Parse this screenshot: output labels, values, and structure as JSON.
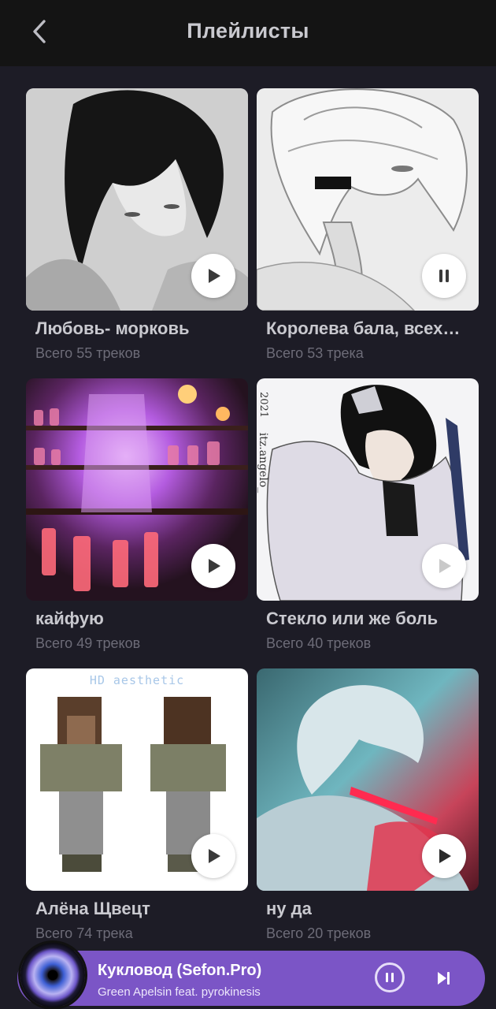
{
  "header": {
    "title": "Плейлисты",
    "back_icon": "chevron-left-icon"
  },
  "playlists": [
    {
      "name": "Любовь- морковь",
      "count": "Всего 55 треков",
      "state": "play"
    },
    {
      "name": "Королева бала, всех…",
      "count": "Всего 53 трека",
      "state": "pause"
    },
    {
      "name": "кайфую",
      "count": "Всего 49 треков",
      "state": "play"
    },
    {
      "name": "Стекло или же боль",
      "count": "Всего 40 треков",
      "state": "play"
    },
    {
      "name": "Алёна Щвецт",
      "count": "Всего 74 трека",
      "state": "play"
    },
    {
      "name": "ну да",
      "count": "Всего 20 треков",
      "state": "play"
    }
  ],
  "cover_texts": {
    "fourth_watermark_1": "2021",
    "fourth_watermark_2": "itz.angelo_",
    "fifth_watermark": "HD aesthetic"
  },
  "player": {
    "title": "Кукловод (Sefon.Pro)",
    "artist": "Green Apelsin feat. pyrokinesis",
    "pause_icon": "pause-icon",
    "next_icon": "skip-next-icon"
  },
  "colors": {
    "background": "#1d1c26",
    "topbar": "#141414",
    "player_accent": "#7b55c6",
    "muted_text": "#6d6c78"
  }
}
